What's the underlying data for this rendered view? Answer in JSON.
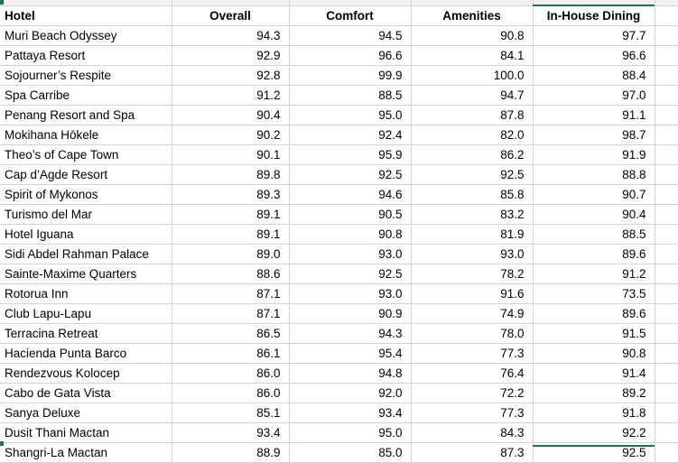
{
  "table": {
    "columns": [
      {
        "key": "hotel",
        "label": "Hotel",
        "align": "left"
      },
      {
        "key": "overall",
        "label": "Overall",
        "align": "right"
      },
      {
        "key": "comfort",
        "label": "Comfort",
        "align": "right"
      },
      {
        "key": "amenities",
        "label": "Amenities",
        "align": "right"
      },
      {
        "key": "dining",
        "label": "In-House Dining",
        "align": "right"
      }
    ],
    "selected_column": "In-House Dining",
    "selection_color": "#217346",
    "gridline_color": "#d4d4d4",
    "rows": [
      {
        "hotel": "Muri Beach Odyssey",
        "overall": "94.3",
        "comfort": "94.5",
        "amenities": "90.8",
        "dining": "97.7"
      },
      {
        "hotel": "Pattaya Resort",
        "overall": "92.9",
        "comfort": "96.6",
        "amenities": "84.1",
        "dining": "96.6"
      },
      {
        "hotel": "Sojourner’s Respite",
        "overall": "92.8",
        "comfort": "99.9",
        "amenities": "100.0",
        "dining": "88.4"
      },
      {
        "hotel": "Spa Carribe",
        "overall": "91.2",
        "comfort": "88.5",
        "amenities": "94.7",
        "dining": "97.0"
      },
      {
        "hotel": "Penang Resort and Spa",
        "overall": "90.4",
        "comfort": "95.0",
        "amenities": "87.8",
        "dining": "91.1"
      },
      {
        "hotel": "Mokihana Hōkele",
        "overall": "90.2",
        "comfort": "92.4",
        "amenities": "82.0",
        "dining": "98.7"
      },
      {
        "hotel": "Theo’s of Cape Town",
        "overall": "90.1",
        "comfort": "95.9",
        "amenities": "86.2",
        "dining": "91.9"
      },
      {
        "hotel": "Cap d’Agde Resort",
        "overall": "89.8",
        "comfort": "92.5",
        "amenities": "92.5",
        "dining": "88.8"
      },
      {
        "hotel": "Spirit of Mykonos",
        "overall": "89.3",
        "comfort": "94.6",
        "amenities": "85.8",
        "dining": "90.7"
      },
      {
        "hotel": "Turismo del Mar",
        "overall": "89.1",
        "comfort": "90.5",
        "amenities": "83.2",
        "dining": "90.4"
      },
      {
        "hotel": "Hotel Iguana",
        "overall": "89.1",
        "comfort": "90.8",
        "amenities": "81.9",
        "dining": "88.5"
      },
      {
        "hotel": "Sidi Abdel Rahman Palace",
        "overall": "89.0",
        "comfort": "93.0",
        "amenities": "93.0",
        "dining": "89.6"
      },
      {
        "hotel": "Sainte-Maxime Quarters",
        "overall": "88.6",
        "comfort": "92.5",
        "amenities": "78.2",
        "dining": "91.2"
      },
      {
        "hotel": "Rotorua Inn",
        "overall": "87.1",
        "comfort": "93.0",
        "amenities": "91.6",
        "dining": "73.5"
      },
      {
        "hotel": "Club Lapu-Lapu",
        "overall": "87.1",
        "comfort": "90.9",
        "amenities": "74.9",
        "dining": "89.6"
      },
      {
        "hotel": "Terracina Retreat",
        "overall": "86.5",
        "comfort": "94.3",
        "amenities": "78.0",
        "dining": "91.5"
      },
      {
        "hotel": "Hacienda Punta Barco",
        "overall": "86.1",
        "comfort": "95.4",
        "amenities": "77.3",
        "dining": "90.8"
      },
      {
        "hotel": "Rendezvous Kolocep",
        "overall": "86.0",
        "comfort": "94.8",
        "amenities": "76.4",
        "dining": "91.4"
      },
      {
        "hotel": "Cabo de Gata Vista",
        "overall": "86.0",
        "comfort": "92.0",
        "amenities": "72.2",
        "dining": "89.2"
      },
      {
        "hotel": "Sanya Deluxe",
        "overall": "85.1",
        "comfort": "93.4",
        "amenities": "77.3",
        "dining": "91.8"
      },
      {
        "hotel": "Dusit Thani Mactan",
        "overall": "93.4",
        "comfort": "95.0",
        "amenities": "84.3",
        "dining": "92.2"
      },
      {
        "hotel": "Shangri-La Mactan",
        "overall": "88.9",
        "comfort": "85.0",
        "amenities": "87.3",
        "dining": "92.5"
      }
    ]
  }
}
